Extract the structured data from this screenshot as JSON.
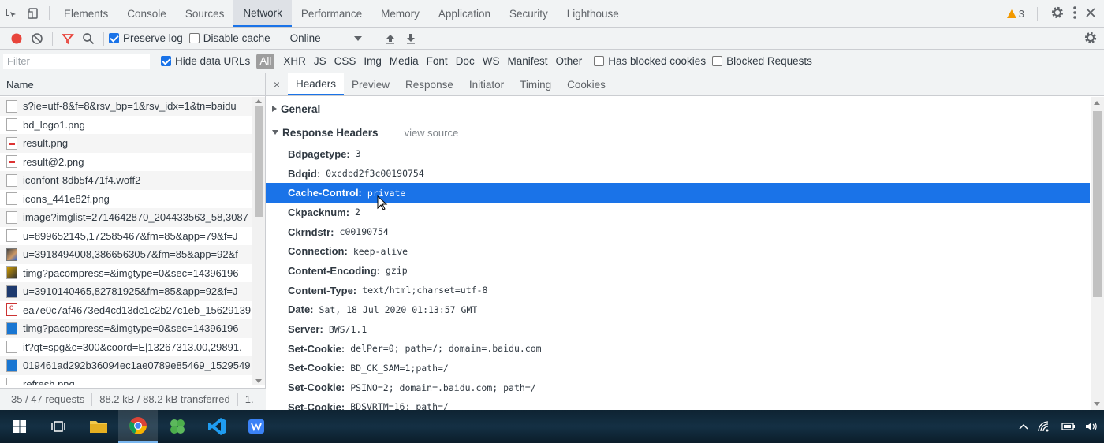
{
  "main_tabs": {
    "items": [
      "Elements",
      "Console",
      "Sources",
      "Network",
      "Performance",
      "Memory",
      "Application",
      "Security",
      "Lighthouse"
    ],
    "active": "Network",
    "warning_count": "3"
  },
  "network_toolbar": {
    "preserve_log_label": "Preserve log",
    "preserve_log_checked": true,
    "disable_cache_label": "Disable cache",
    "disable_cache_checked": false,
    "throttling_value": "Online"
  },
  "filter_bar": {
    "filter_placeholder": "Filter",
    "hide_data_urls_label": "Hide data URLs",
    "hide_data_urls_checked": true,
    "types": [
      "All",
      "XHR",
      "JS",
      "CSS",
      "Img",
      "Media",
      "Font",
      "Doc",
      "WS",
      "Manifest",
      "Other"
    ],
    "active_type": "All",
    "has_blocked_cookies_label": "Has blocked cookies",
    "blocked_requests_label": "Blocked Requests"
  },
  "request_list": {
    "column_name": "Name",
    "requests": [
      {
        "name": "s?ie=utf-8&f=8&rsv_bp=1&rsv_idx=1&tn=baidu",
        "icon": "document-icon"
      },
      {
        "name": "bd_logo1.png",
        "icon": "file-icon"
      },
      {
        "name": "result.png",
        "icon": "image-icon"
      },
      {
        "name": "result@2.png",
        "icon": "image-icon"
      },
      {
        "name": "iconfont-8db5f471f4.woff2",
        "icon": "file-icon"
      },
      {
        "name": "icons_441e82f.png",
        "icon": "file-icon"
      },
      {
        "name": "image?imglist=2714642870_204433563_58,3087",
        "icon": "file-icon"
      },
      {
        "name": "u=899652145,172585467&fm=85&app=79&f=J",
        "icon": "file-icon"
      },
      {
        "name": "u=3918494008,3866563057&fm=85&app=92&f",
        "icon": "thumbnail-icon"
      },
      {
        "name": "timg?pacompress=&imgtype=0&sec=14396196",
        "icon": "thumbnail-icon"
      },
      {
        "name": "u=3910140465,82781925&fm=85&app=92&f=J",
        "icon": "thumbnail-icon"
      },
      {
        "name": "ea7e0c7af4673ed4cd13dc1c2b27c1eb_15629139",
        "icon": "script-icon"
      },
      {
        "name": "timg?pacompress=&imgtype=0&sec=14396196",
        "icon": "thumbnail-icon"
      },
      {
        "name": "it?qt=spg&c=300&coord=E|13267313.00,29891.",
        "icon": "file-icon"
      },
      {
        "name": "019461ad292b36094ec1ae0789e85469_1529549",
        "icon": "thumbnail-icon"
      },
      {
        "name": "refresh.png",
        "icon": "file-icon"
      }
    ],
    "status_requests": "35 / 47 requests",
    "status_transferred": "88.2 kB / 88.2 kB transferred",
    "status_more": "1."
  },
  "details": {
    "close_glyph": "×",
    "tabs": [
      "Headers",
      "Preview",
      "Response",
      "Initiator",
      "Timing",
      "Cookies"
    ],
    "active_tab": "Headers",
    "general_label": "General",
    "response_headers_label": "Response Headers",
    "view_source_label": "view source",
    "headers": [
      {
        "name": "Bdpagetype:",
        "value": "3"
      },
      {
        "name": "Bdqid:",
        "value": "0xcdbd2f3c00190754"
      },
      {
        "name": "Cache-Control:",
        "value": "private"
      },
      {
        "name": "Ckpacknum:",
        "value": "2"
      },
      {
        "name": "Ckrndstr:",
        "value": "c00190754"
      },
      {
        "name": "Connection:",
        "value": "keep-alive"
      },
      {
        "name": "Content-Encoding:",
        "value": "gzip"
      },
      {
        "name": "Content-Type:",
        "value": "text/html;charset=utf-8"
      },
      {
        "name": "Date:",
        "value": "Sat, 18 Jul 2020 01:13:57 GMT"
      },
      {
        "name": "Server:",
        "value": "BWS/1.1"
      },
      {
        "name": "Set-Cookie:",
        "value": "delPer=0; path=/; domain=.baidu.com"
      },
      {
        "name": "Set-Cookie:",
        "value": "BD_CK_SAM=1;path=/"
      },
      {
        "name": "Set-Cookie:",
        "value": "PSINO=2; domain=.baidu.com; path=/"
      },
      {
        "name": "Set-Cookie:",
        "value": "BDSVRTM=16; path=/"
      }
    ],
    "selected_header_index": 2
  },
  "colors": {
    "accent": "#1a73e8",
    "record": "#e8453c",
    "warning": "#f29900"
  }
}
